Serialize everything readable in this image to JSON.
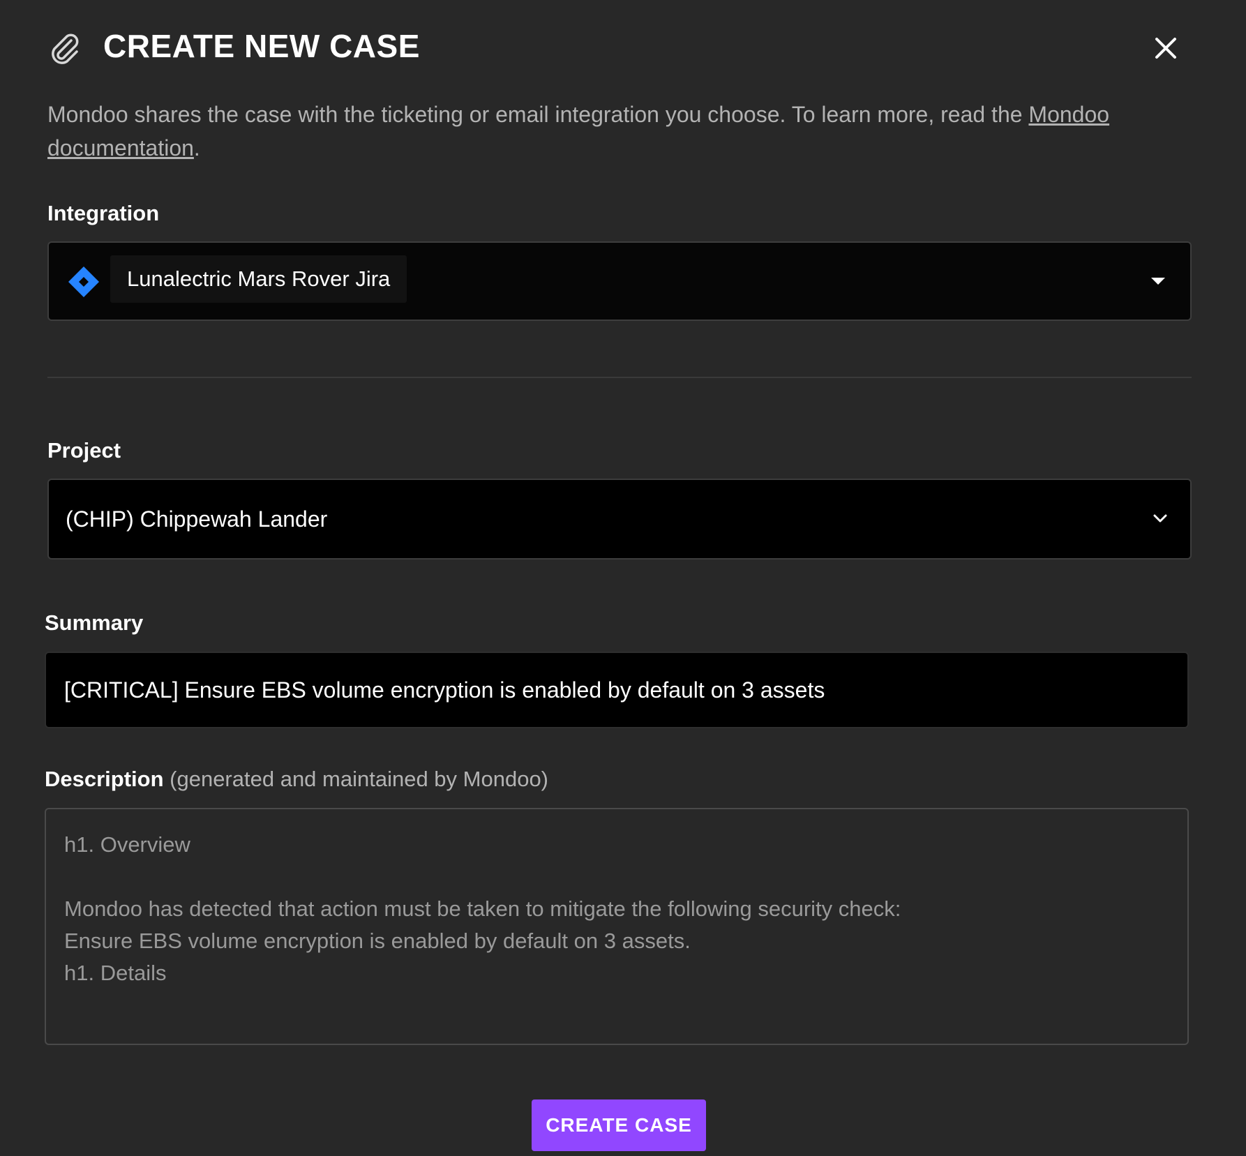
{
  "dialog": {
    "title": "CREATE NEW CASE",
    "intro_text": "Mondoo shares the case with the ticketing or email integration you choose. To learn more, read the ",
    "intro_link": "Mondoo documentation",
    "intro_end": "."
  },
  "integration": {
    "label": "Integration",
    "selected": "Lunalectric Mars Rover Jira",
    "icon": "jira-icon"
  },
  "project": {
    "label": "Project",
    "selected": "(CHIP) Chippewah Lander"
  },
  "summary": {
    "label": "Summary",
    "value": "[CRITICAL] Ensure EBS volume encryption is enabled by default on 3 assets"
  },
  "description": {
    "label": "Description",
    "sublabel": " (generated and maintained by Mondoo)",
    "value": "h1. Overview\n\nMondoo has detected that action must be taken to mitigate the following security check:\nEnsure EBS volume encryption is enabled by default on 3 assets.\nh1. Details"
  },
  "actions": {
    "create_label": "CREATE CASE"
  },
  "colors": {
    "background": "#282828",
    "accent": "#9147ff",
    "jira_blue": "#2684ff"
  }
}
